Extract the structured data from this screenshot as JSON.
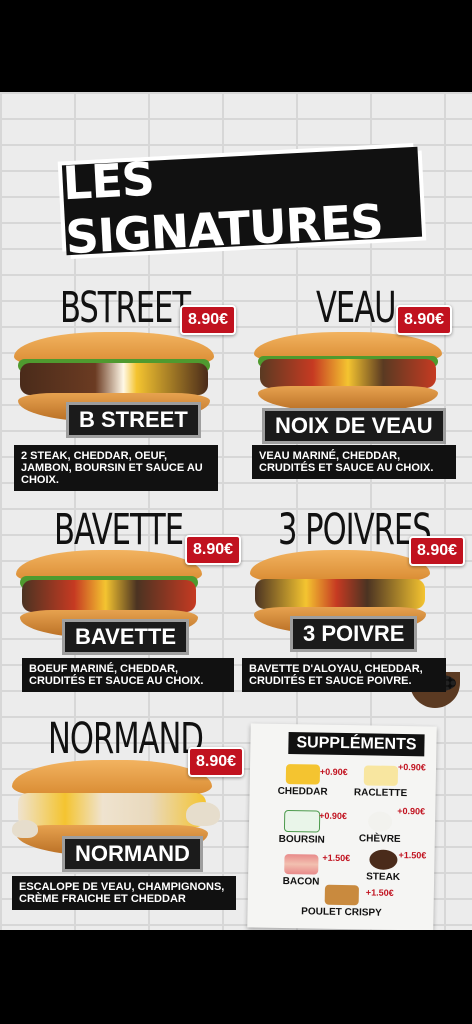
{
  "poster": {
    "title": "Les Signatures",
    "items": [
      {
        "scrawl": "Bstreet",
        "price": "8.90€",
        "label": "B Street",
        "desc": "2 steak, cheddar, oeuf, jambon, boursin et sauce au choix."
      },
      {
        "scrawl": "Veau",
        "price": "8.90€",
        "label": "Noix de veau",
        "desc": "Veau mariné, cheddar, crudités et sauce au choix."
      },
      {
        "scrawl": "Bavette",
        "price": "8.90€",
        "label": "Bavette",
        "desc": "Boeuf mariné, cheddar, crudités et sauce au choix."
      },
      {
        "scrawl": "3 Poivres",
        "price": "8.90€",
        "label": "3 Poivre",
        "desc": "Bavette d'aloyau, cheddar, crudités et sauce poivre."
      },
      {
        "scrawl": "Normand",
        "price": "8.90€",
        "label": "Normand",
        "desc": "Escalope de veau, champignons, crème fraiche et cheddar"
      }
    ],
    "supplements": {
      "title": "Suppléments",
      "items": [
        {
          "name": "Cheddar",
          "price": "+0.90€"
        },
        {
          "name": "Raclette",
          "price": "+0.90€"
        },
        {
          "name": "Boursin",
          "price": "+0.90€"
        },
        {
          "name": "Chèvre",
          "price": "+0.90€"
        },
        {
          "name": "Bacon",
          "price": "+1.50€"
        },
        {
          "name": "Steak",
          "price": "+1.50€"
        },
        {
          "name": "Poulet Crispy",
          "price": "+1.50€"
        }
      ]
    }
  },
  "colors": {
    "price_red": "#c1121f",
    "label_bg": "#1b1b1b",
    "brick": "#ececec"
  }
}
